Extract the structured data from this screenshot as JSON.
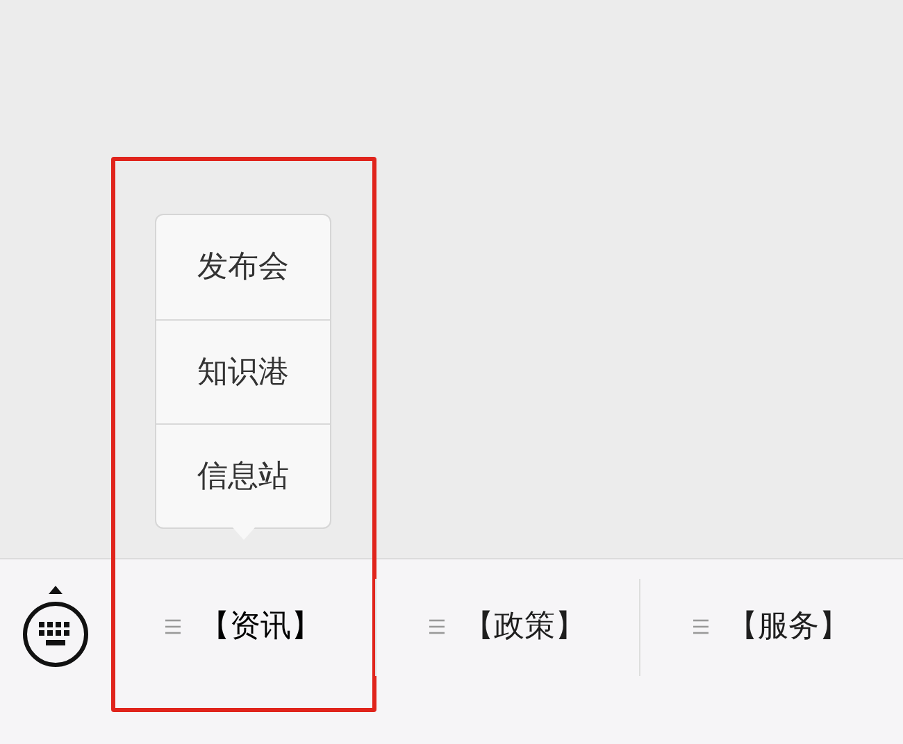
{
  "menu_bar": {
    "items": [
      {
        "label": "【资讯】",
        "expanded": true,
        "highlighted": true,
        "submenu": [
          "发布会",
          "知识港",
          "信息站"
        ]
      },
      {
        "label": "【政策】",
        "expanded": false,
        "highlighted": false
      },
      {
        "label": "【服务】",
        "expanded": false,
        "highlighted": false
      }
    ]
  }
}
